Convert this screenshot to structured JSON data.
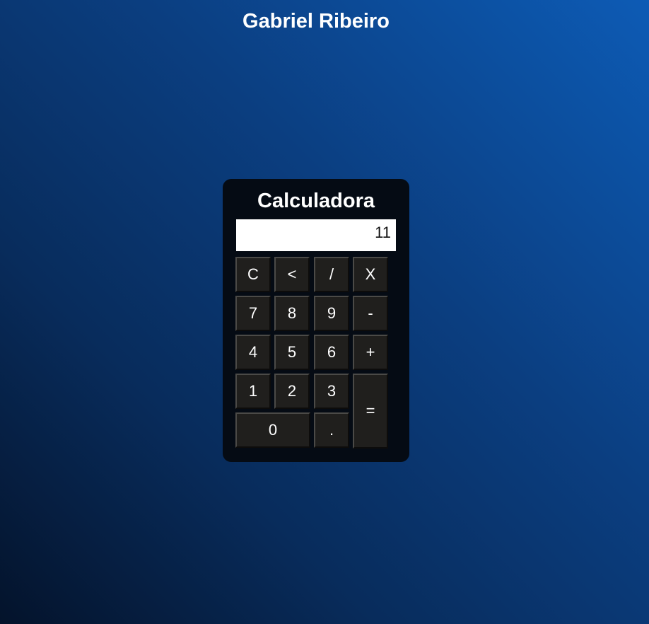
{
  "header": {
    "title": "Gabriel Ribeiro"
  },
  "calculator": {
    "title": "Calculadora",
    "display_value": "11",
    "keys": {
      "clear": "C",
      "backspace": "<",
      "divide": "/",
      "multiply": "X",
      "seven": "7",
      "eight": "8",
      "nine": "9",
      "subtract": "-",
      "four": "4",
      "five": "5",
      "six": "6",
      "add": "+",
      "one": "1",
      "two": "2",
      "three": "3",
      "equals": "=",
      "zero": "0",
      "decimal": "."
    }
  },
  "colors": {
    "background_light": "#0d5bb5",
    "background_dark": "#04132b",
    "panel": "#050b14",
    "key": "#201f1d",
    "display": "#ffffff"
  }
}
